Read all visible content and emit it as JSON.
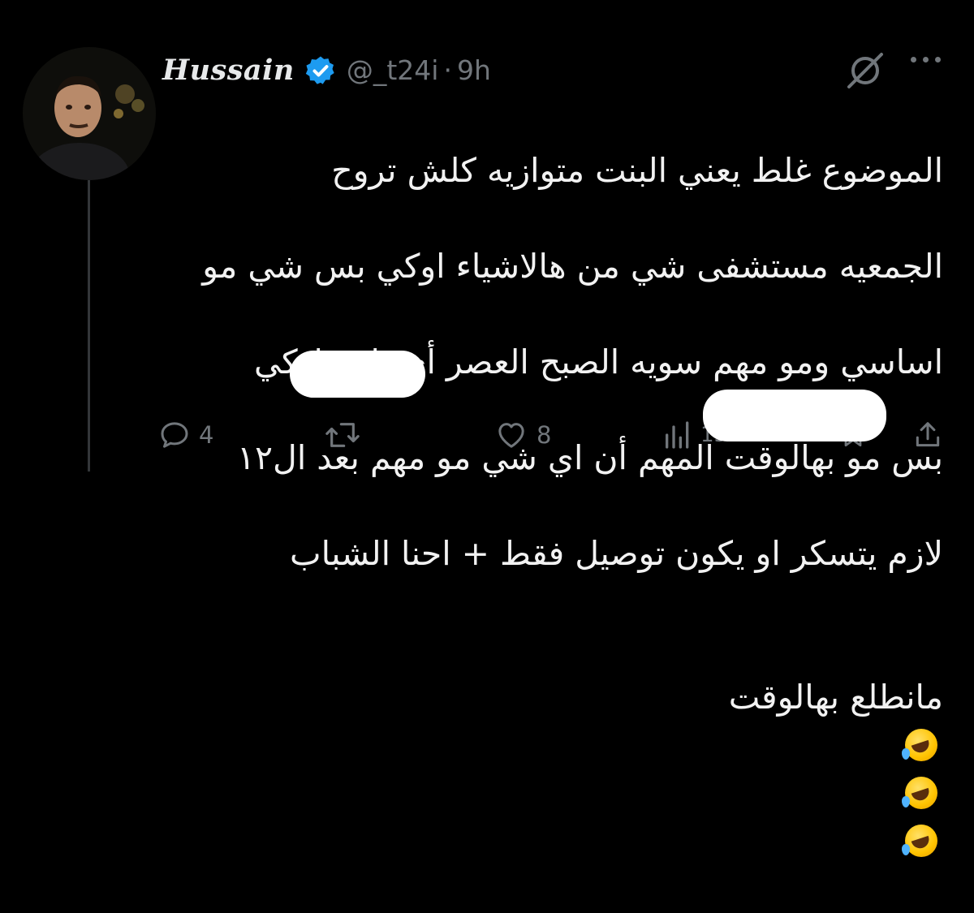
{
  "tweet": {
    "author": {
      "display_name": "Hussain",
      "handle": "@_t24i",
      "verified": true
    },
    "separator": "·",
    "time": "9h",
    "text_lines": [
      "الموضوع غلط يعني البنت متوازيه كلش تروح",
      "الجمعيه مستشفى شي من هالاشياء اوكي بس شي مو",
      "اساسي ومو مهم سويه الصبح العصر أي ثاني اوكي",
      "بس مو بهالوقت المهم أن اي شي مو مهم بعد ال١٢",
      "لازم يتسكر او يكون توصيل فقط + احنا الشباب"
    ],
    "last_line_text": "مانطلع بهالوقت",
    "last_line_emoji": "rolling-on-floor-laughing",
    "emoji_count_in_last_line": 3
  },
  "actions": {
    "reply": {
      "icon": "reply-icon",
      "count": "4"
    },
    "retweet": {
      "icon": "retweet-icon",
      "count": ""
    },
    "like": {
      "icon": "heart-icon",
      "count": "8"
    },
    "views": {
      "icon": "views-icon",
      "count": "15K"
    },
    "bookmark": {
      "icon": "bookmark-icon"
    },
    "share": {
      "icon": "share-icon"
    }
  },
  "colors": {
    "background": "#000000",
    "text": "#e7e9ea",
    "muted": "#71767b",
    "verified": "#1d9bf0",
    "redaction": "#ffffff"
  }
}
